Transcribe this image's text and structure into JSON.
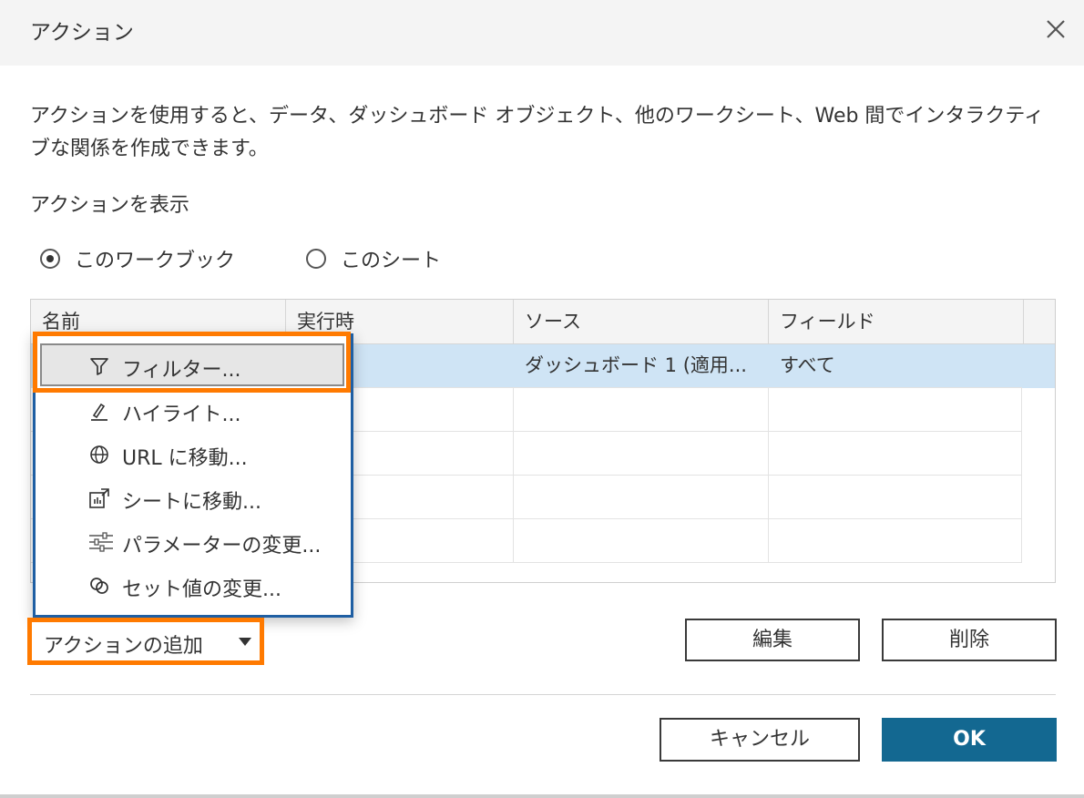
{
  "dialog": {
    "title": "アクション",
    "description": "アクションを使用すると、データ、ダッシュボード オブジェクト、他のワークシート、Web 間でインタラクティブな関係を作成できます。",
    "show_label": "アクションを表示"
  },
  "radios": [
    {
      "label": "このワークブック",
      "selected": true
    },
    {
      "label": "このシート",
      "selected": false
    }
  ],
  "table": {
    "columns": [
      "名前",
      "実行時",
      "ソース",
      "フィールド"
    ],
    "rows": [
      {
        "name": "",
        "run_on": "",
        "source": "ダッシュボード 1 (適用...",
        "fields": "すべて",
        "selected": true
      }
    ]
  },
  "menu": {
    "items": [
      {
        "label": "フィルター...",
        "icon": "filter-icon"
      },
      {
        "label": "ハイライト...",
        "icon": "highlight-icon"
      },
      {
        "label": "URL に移動...",
        "icon": "globe-icon"
      },
      {
        "label": "シートに移動...",
        "icon": "goto-sheet-icon"
      },
      {
        "label": "パラメーターの変更...",
        "icon": "parameter-icon"
      },
      {
        "label": "セット値の変更...",
        "icon": "set-icon"
      }
    ]
  },
  "buttons": {
    "add_action": "アクションの追加",
    "edit": "編集",
    "delete": "削除",
    "cancel": "キャンセル",
    "ok": "OK"
  },
  "colors": {
    "highlight_orange": "#ff7a00",
    "menu_border": "#1f5fa3",
    "selection_blue": "#cfe4f5",
    "ok_button": "#136891"
  }
}
